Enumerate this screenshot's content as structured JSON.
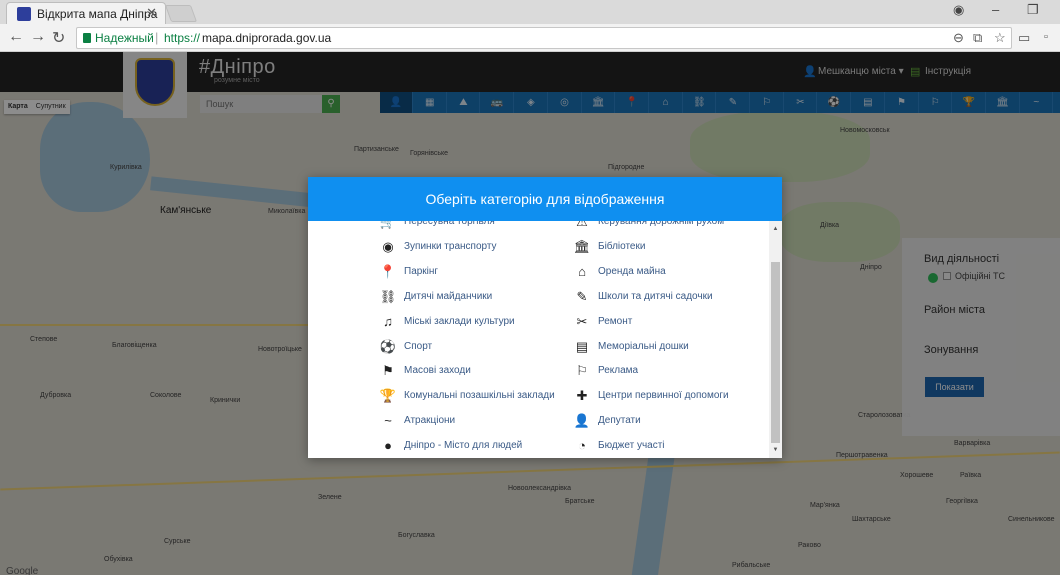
{
  "browser": {
    "tab_title": "Відкрита мапа Дніпра",
    "secure_label": "Надежный",
    "url_protocol": "https://",
    "url_rest": "mapa.dniprorada.gov.ua"
  },
  "header": {
    "brand": "#Дніпро",
    "brand_sub": "розумне місто",
    "residents_link": "Мешканцю міста ▾",
    "instructions_link": "Інструкція"
  },
  "map": {
    "type_map": "Карта",
    "type_satellite": "Супутник",
    "search_placeholder": "Пошук",
    "labels": [
      "Лошкарівка",
      "Партизанське",
      "Горянівське",
      "Підгородне",
      "Кам'янське",
      "Курилівка",
      "Миколаївка",
      "Новомосковськ",
      "Таромське",
      "Обухівка",
      "Дніпро",
      "Діївка",
      "Степове",
      "Сурське",
      "Олександрівка",
      "Новоолександрівка",
      "Братське",
      "Волоське",
      "Рибальське",
      "Чумаки",
      "Дубровка",
      "Підпільне",
      "Сергіївка",
      "Солоне",
      "Дзержинівка",
      "Новостепове",
      "Семенівка",
      "Благовіщенка",
      "Новотроїцьке",
      "Соколове",
      "Кринички",
      "Зелене",
      "Богуславка",
      "Варварівка",
      "Раївка",
      "Хорошеве",
      "Георгіївка",
      "Мар'янка",
      "Першотравенка",
      "Старолозоватка",
      "Миколаївка",
      "Шахтарське",
      "Синельникове",
      "Раково",
      "Новопокровка",
      "Пушкарівка",
      "Ракове",
      "Обухівка",
      "Сурське"
    ],
    "google": "Google"
  },
  "side_panel": {
    "activity": "Вид діяльності",
    "official": "Офіційні ТС",
    "district": "Район міста",
    "zoning": "Зонування",
    "show": "Показати"
  },
  "modal": {
    "title": "Оберіть категорію для відображення",
    "left": [
      {
        "icon": "🛒",
        "label": "Пересувна торгівля"
      },
      {
        "icon": "◉",
        "label": "Зупинки транспорту"
      },
      {
        "icon": "📍",
        "label": "Паркінг"
      },
      {
        "icon": "⛓",
        "label": "Дитячі майданчики"
      },
      {
        "icon": "♫",
        "label": "Міські заклади культури"
      },
      {
        "icon": "⚽",
        "label": "Спорт"
      },
      {
        "icon": "⚑",
        "label": "Масові заходи"
      },
      {
        "icon": "🏆",
        "label": "Комунальні позашкільні заклади"
      },
      {
        "icon": "~",
        "label": "Атракціони"
      },
      {
        "icon": "●",
        "label": "Дніпро - Місто для людей"
      }
    ],
    "right": [
      {
        "icon": "⚠",
        "label": "Керування дорожнім рухом"
      },
      {
        "icon": "🏛",
        "label": "Бібліотеки"
      },
      {
        "icon": "⌂",
        "label": "Оренда майна"
      },
      {
        "icon": "✎",
        "label": "Школи та дитячі садочки"
      },
      {
        "icon": "✂",
        "label": "Ремонт"
      },
      {
        "icon": "▤",
        "label": "Меморіальні дошки"
      },
      {
        "icon": "⚐",
        "label": "Реклама"
      },
      {
        "icon": "✚",
        "label": "Центри первинної допомоги"
      },
      {
        "icon": "👤",
        "label": "Депутати"
      },
      {
        "icon": "◔",
        "label": "Бюджет участі"
      }
    ]
  },
  "toolbar_icons": [
    "👤",
    "▦",
    "⛰",
    "🚌",
    "◈",
    "◎",
    "🏛",
    "📍",
    "⌂",
    "⛓",
    "✎",
    "⚐",
    "✂",
    "⚽",
    "▤",
    "⚑",
    "⚐",
    "🏆",
    "🏛",
    "~"
  ]
}
